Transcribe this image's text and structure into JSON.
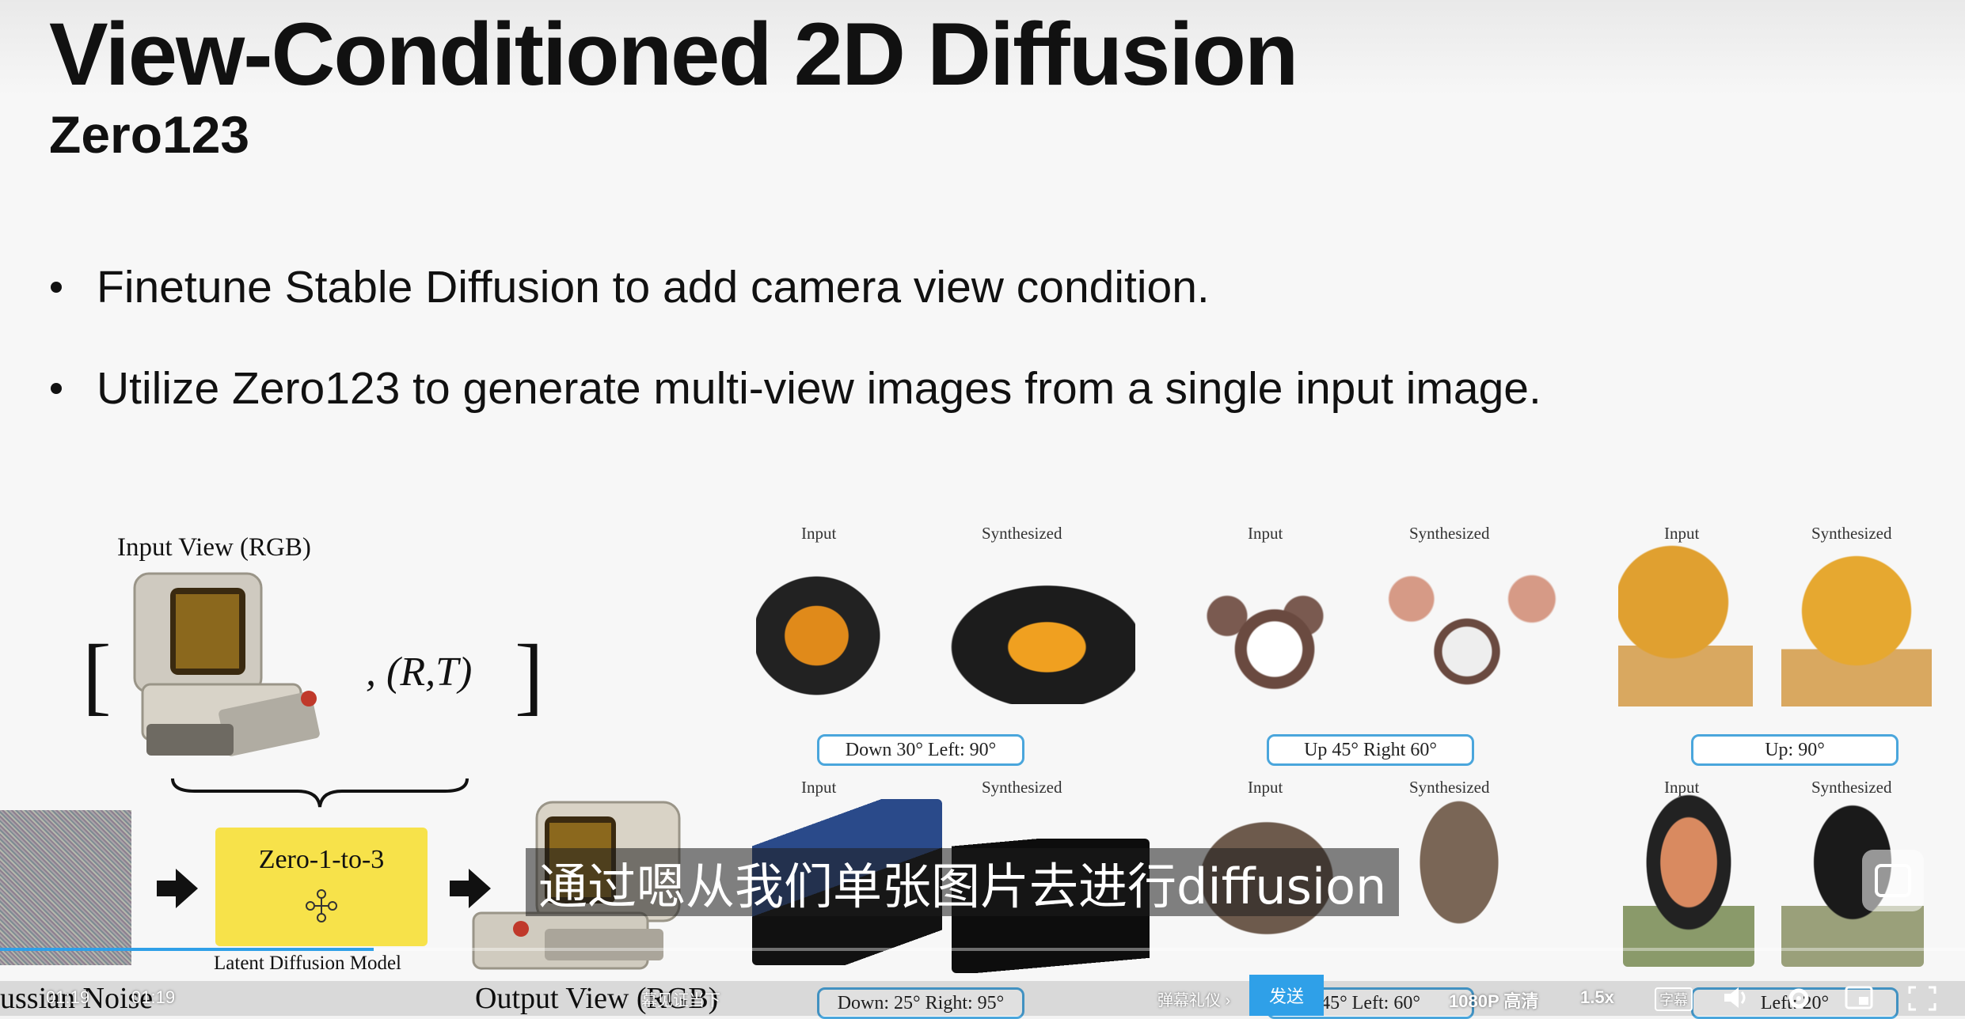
{
  "slide": {
    "title": "View-Conditioned 2D Diffusion",
    "subtitle": "Zero123",
    "bullets": [
      "Finetune Stable Diffusion to add camera view condition.",
      "Utilize Zero123 to generate multi-view images from a single input image."
    ],
    "diagram": {
      "input_view_label": "Input View (RGB)",
      "rt_label": ", (R,T)",
      "model_label": "Zero-1-to-3",
      "latent_label": "Latent Diffusion Model",
      "noise_label": "ussian Noise",
      "output_label": "Output View (RGB)"
    },
    "examples": {
      "input_label": "Input",
      "synth_label": "Synthesized",
      "row1_pills": [
        "Down 30°  Left: 90°",
        "Up 45° Right 60°",
        "Up: 90°"
      ],
      "row2_pills": [
        "Down: 25°  Right: 95°",
        "45°  Left: 60°",
        "Left: 20°"
      ]
    }
  },
  "player": {
    "subtitle_text": "通过嗯从我们单张图片去进行diffusion",
    "time": "01:19",
    "duration": "01:19",
    "danmaku_hint": "幕见证当下",
    "danmaku_gift": "弹幕礼仪 ›",
    "send_label": "发送",
    "quality": "1080P 高清",
    "speed": "1.5x",
    "subtitle_btn": "字幕",
    "progress": 0.19,
    "colors": {
      "accent": "#2fa0e8",
      "highlight": "#f7e24a"
    }
  }
}
